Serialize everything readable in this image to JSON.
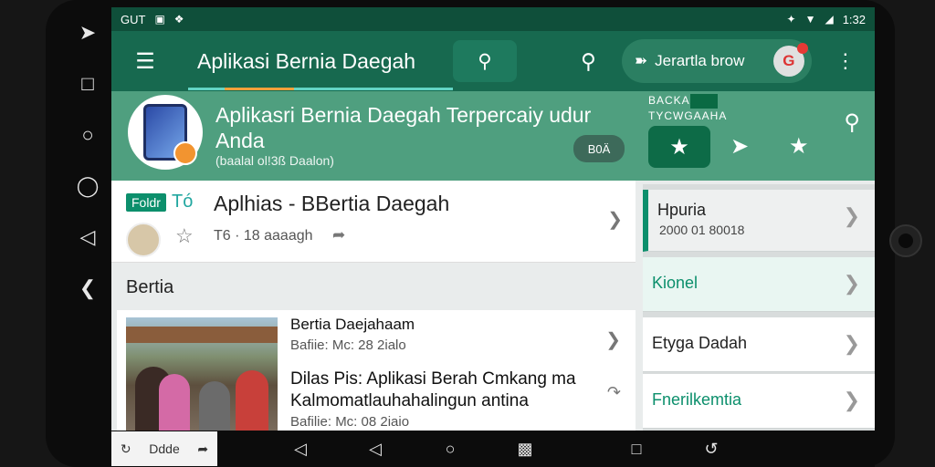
{
  "status_bar": {
    "carrier": "GUT",
    "time": "1:32",
    "icons_left": [
      "image-icon",
      "grid-icon"
    ],
    "icons_right": [
      "vibrate-icon",
      "wifi-icon",
      "signal-icon"
    ]
  },
  "app_bar": {
    "title": "Aplikasi Bernia Daegah",
    "pill_label": "Jerartla brow",
    "icons": [
      "menu-icon",
      "search-icon",
      "more-icon"
    ]
  },
  "hero": {
    "heading": "Aplikasri Bernia Daegah Terpercaiy udur Anda",
    "sub": "(baalal ol!3ß Daalon)",
    "chat_label": "B0Ä",
    "mini_title_line1": "BACKA",
    "mini_title_line2": "TYCWGAAHA"
  },
  "top_card": {
    "tag": "Foldr",
    "tag2": "Tó",
    "title": "Aplhias - BBertia Daegah",
    "meta": "T6 · 18 aaaagh"
  },
  "section": {
    "label": "Bertia"
  },
  "news": [
    {
      "title": "Bertia Daejahaam",
      "meta": "Bafiie: Mc: 28 2ialo"
    },
    {
      "title": "Dilas Pis: Aplikasi Berah Cmkang ma Kalmomatlauhahalingun antina",
      "meta": "Bafilie: Mc: 08 2iaio"
    }
  ],
  "side_panel": [
    {
      "label": "Hpuria",
      "sub": "2000 01 80018"
    },
    {
      "label": "Kionel",
      "sub": ""
    },
    {
      "label": "Etyga Dadah",
      "sub": ""
    },
    {
      "label": "Fnerilkemtia",
      "sub": ""
    }
  ],
  "bottom_tile": {
    "label": "Ddde"
  }
}
